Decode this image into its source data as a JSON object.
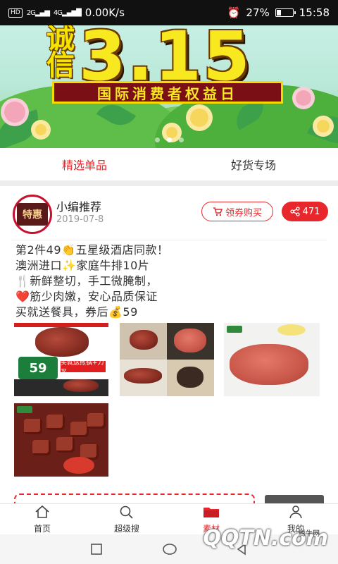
{
  "status_bar": {
    "network_speed": "0.00K/s",
    "signal_1": "2G",
    "signal_2": "4G",
    "battery_percent": "27%",
    "battery_level": 0.27,
    "time": "15:58",
    "hd_label": "HD"
  },
  "banner": {
    "title_chars": [
      "诚",
      "信"
    ],
    "title_number": "3.15",
    "subtitle": "国际消费者权益日",
    "page_count": 3,
    "active_index": 1
  },
  "tabs": [
    {
      "label": "精选单品",
      "active": true
    },
    {
      "label": "好货专场",
      "active": false
    }
  ],
  "post": {
    "avatar_text": "特惠",
    "author": "小编推荐",
    "date": "2019-07-8",
    "coupon_button": "领券购买",
    "share_count": "471",
    "description_lines": [
      "第2件49👏五星级酒店同款！",
      "澳洲进口✨家庭牛排10片",
      "🍴新鲜整切，手工微腌制，",
      "❤️筋少肉嫩，安心品质保证",
      "买就送餐具，券后💰59"
    ],
    "image1": {
      "price": "59",
      "promo": "买就送煎锅+刀叉"
    }
  },
  "bottom_nav": [
    {
      "label": "首页",
      "icon": "home-icon",
      "active": false
    },
    {
      "label": "超级搜",
      "icon": "search-icon",
      "active": false
    },
    {
      "label": "素材",
      "icon": "folder-icon",
      "active": true
    },
    {
      "label": "我的",
      "icon": "user-icon",
      "active": false
    }
  ],
  "watermark": {
    "text": "QQTN.com",
    "small": "腾牛网"
  },
  "colors": {
    "accent": "#e8272c",
    "status_bar": "#111111",
    "banner_sub_bg": "#7a0f15"
  }
}
